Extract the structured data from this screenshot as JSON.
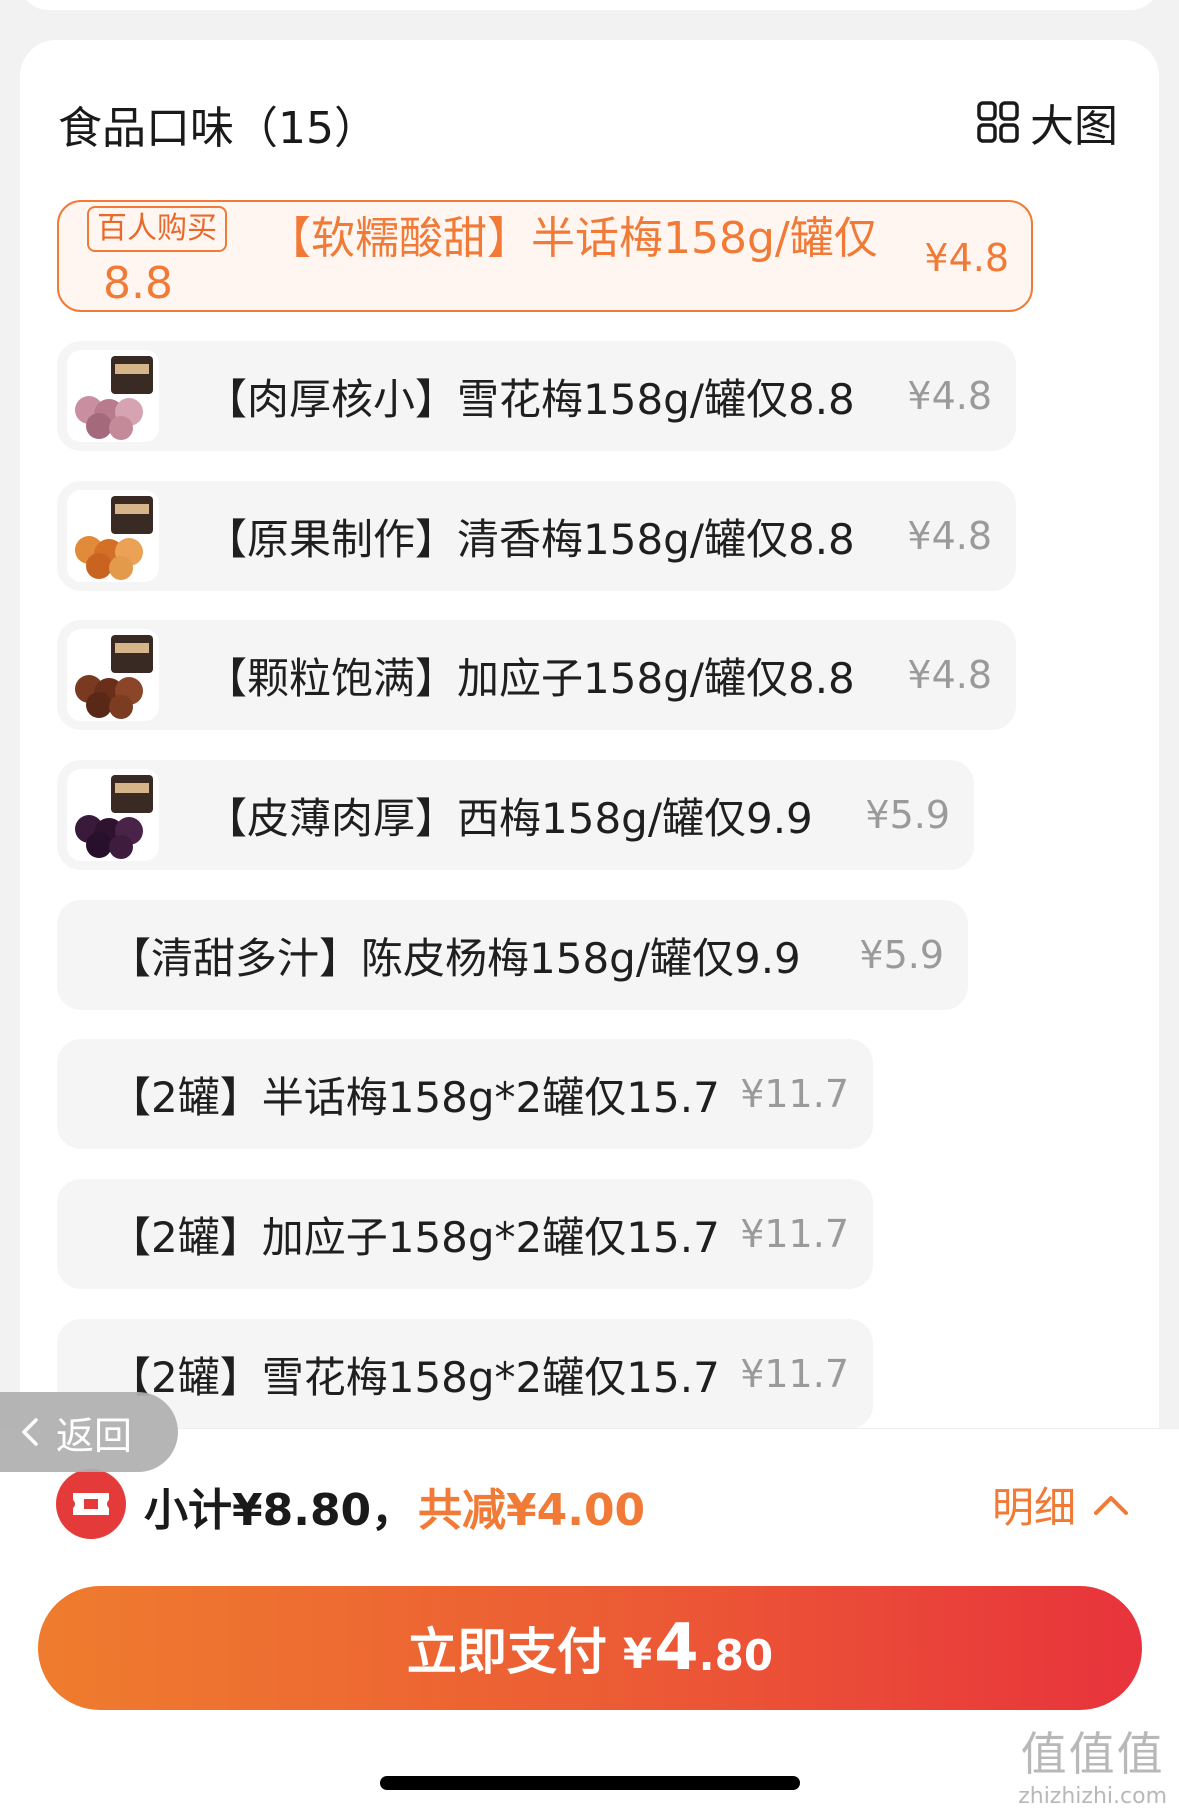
{
  "header": {
    "title": "食品口味（15）",
    "view_toggle_label": "大图"
  },
  "options": [
    {
      "badge": "百人购买",
      "name_line1": "【软糯酸甜】半话梅158g/罐仅",
      "name_line2": "8.8",
      "price": "¥4.8",
      "selected": true
    },
    {
      "name": "【肉厚核小】雪花梅158g/罐仅8.8",
      "price": "¥4.8",
      "thumb": "thumb-pink-plums"
    },
    {
      "name": "【原果制作】清香梅158g/罐仅8.8",
      "price": "¥4.8",
      "thumb": "thumb-orange-plums"
    },
    {
      "name": "【颗粒饱满】加应子158g/罐仅8.8",
      "price": "¥4.8",
      "thumb": "thumb-brown-plums"
    },
    {
      "name": "【皮薄肉厚】西梅158g/罐仅9.9",
      "price": "¥5.9",
      "thumb": "thumb-purple-prunes"
    },
    {
      "name": "【清甜多汁】陈皮杨梅158g/罐仅9.9",
      "price": "¥5.9"
    },
    {
      "name": "【2罐】半话梅158g*2罐仅15.7",
      "price": "¥11.7"
    },
    {
      "name": "【2罐】加应子158g*2罐仅15.7",
      "price": "¥11.7"
    },
    {
      "name": "【2罐】雪花梅158g*2罐仅15.7",
      "price": "¥11.7"
    }
  ],
  "back_button": {
    "label": "返回"
  },
  "footer": {
    "subtotal": "小计¥8.80，",
    "discount": "共减¥4.00",
    "details_label": "明细",
    "pay_label": "立即支付",
    "pay_currency": "¥",
    "pay_amount_int": "4",
    "pay_amount_dec": ".80"
  },
  "watermark": {
    "main": "值值值",
    "sub": "zhizhizhi.com"
  },
  "colors": {
    "accent": "#f07a36",
    "pay_start": "#ef7c2e",
    "pay_end": "#e8333c",
    "coupon_red": "#e53a3a"
  }
}
